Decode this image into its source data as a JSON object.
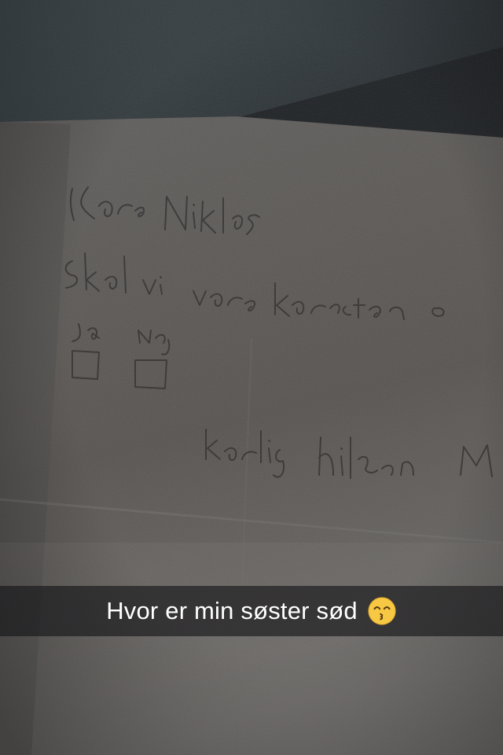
{
  "note": {
    "lines": [
      {
        "text": "Kære Niklas"
      },
      {
        "text": "Skal vi være kæreste ?"
      },
      {
        "text": "Ja"
      },
      {
        "text": "Nej"
      },
      {
        "text": "kærlig hilsen M"
      }
    ]
  },
  "caption": {
    "text": "Hvor er min søster sød",
    "emoji": "kissing-face-with-smiling-eyes-icon"
  },
  "colors": {
    "paper": "#5c5a58",
    "pencil": "#2c2b2b",
    "caption_bg": "#141416",
    "caption_text": "#ffffff",
    "emoji_yellow": "#f7c843"
  }
}
